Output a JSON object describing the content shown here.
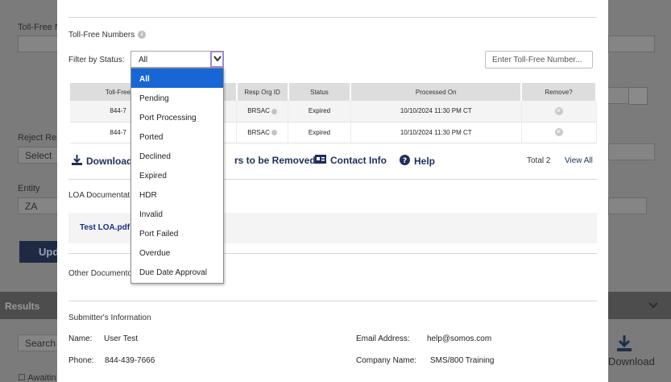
{
  "background": {
    "toll_free_label": "Toll-Free N",
    "reject_label": "Reject Rea",
    "reject_select": "Select",
    "entity_label": "Entity",
    "entity_value": "ZA",
    "update_button": "Upd",
    "results_label": "Results",
    "search_placeholder": "Search",
    "awaiting_label": "Awaitin",
    "download_label": "Download"
  },
  "modal": {
    "section_title": "Toll-Free Numbers",
    "filter_label": "Filter by Status:",
    "filter_value": "All",
    "tfn_placeholder": "Enter Toll-Free Number...",
    "table": {
      "headers": [
        "Toll-Free",
        "Resp Org ID",
        "Status",
        "Processed On",
        "Remove?"
      ],
      "rows": [
        {
          "toll_free": "844-7",
          "resp_org": "BRSAC",
          "status": "Expired",
          "processed_on": "10/10/2024 11:30 PM CT"
        },
        {
          "toll_free": "844-7",
          "resp_org": "BRSAC",
          "status": "Expired",
          "processed_on": "10/10/2024 11:30 PM CT"
        }
      ]
    },
    "actions": {
      "download": "Download",
      "remove": "rs to be Removed",
      "contact": "Contact Info",
      "help": "Help",
      "total": "Total 2",
      "view_all": "View All"
    },
    "loa_title": "LOA Documentat",
    "loa_file": "Test LOA.pdf",
    "other_docs_title": "Other Documento",
    "submitter": {
      "title": "Submitter's Information",
      "name_label": "Name:",
      "name_value": "User Test",
      "phone_label": "Phone:",
      "phone_value": "844-439-7666",
      "email_label": "Email Address:",
      "email_value": "help@somos.com",
      "company_label": "Company Name:",
      "company_value": "SMS/800 Training"
    }
  },
  "dropdown": {
    "options": [
      "All",
      "Pending",
      "Port Processing",
      "Ported",
      "Declined",
      "Expired",
      "HDR",
      "Invalid",
      "Port Failed",
      "Overdue",
      "Due Date Approval"
    ],
    "selected": "All"
  },
  "colors": {
    "accent": "#1866d6",
    "link": "#1f2f5a",
    "focus_border": "#9b8ad8"
  }
}
